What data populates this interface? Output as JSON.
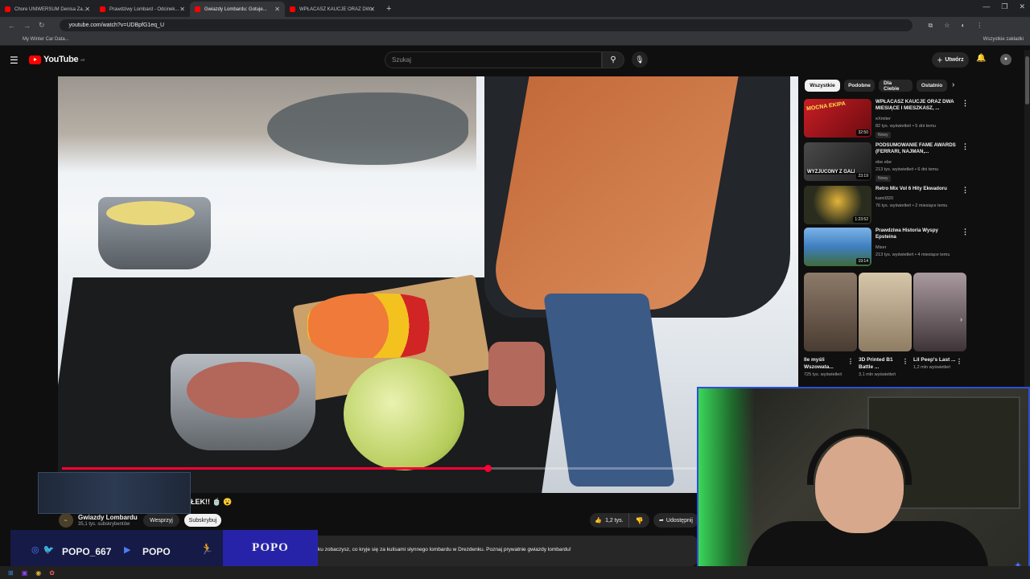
{
  "browser": {
    "tabs": [
      {
        "label": "Chore UNIWERSUM Denisa Za..."
      },
      {
        "label": "Prawdziwy Lombard - Odcinek..."
      },
      {
        "label": "Gwiazdy Lombardu: Gotuje..."
      },
      {
        "label": "WPŁACASZ KAUCJE ORAZ DW..."
      }
    ],
    "url": "youtube.com/watch?v=UDBpfG1eq_U",
    "bookmark": "My Winter Car Data...",
    "all_bookmarks": "Wszystkie zakładki"
  },
  "youtube": {
    "logo": "YouTube",
    "logo_region": "MT",
    "search_placeholder": "Szukaj",
    "create_label": "Utwórz"
  },
  "video": {
    "title_partial": "ŁEK!! 🍵 😮",
    "progress": 0.67,
    "channel": "Gwiazdy Lombardu",
    "subscribers": "35,1 tys. subskrybentów",
    "support_label": "Wesprzyj",
    "subscribe_label": "Subskrybuj",
    "likes": "1,2 tys.",
    "share_label": "Udostępnij",
    "description": "ku zobaczysz, co kryje się za kulisami słynnego lombardu w Drezdenku. Poznaj prywatnie gwiazdy lombardu!"
  },
  "chips": [
    "Wszystkie",
    "Podobne",
    "Dla Ciebie",
    "Ostatnio"
  ],
  "recommendations": [
    {
      "title": "WPŁACASZ KAUCJE ORAZ DWA MIESIĄCE I MIESZKASZ, ...",
      "channel": "eXmiter",
      "meta": "82 tys. wyświetleń • 5 dni temu",
      "badge": "Nowy",
      "duration": "32:50",
      "thumb_label": "MOCNA EKIPA",
      "color": "#b3161f"
    },
    {
      "title": "PODSUMOWANIE FAME AWARDS (FERRARI, NAJMAN,...",
      "channel": "ebe ebe",
      "meta": "213 tys. wyświetleń • 6 dni temu",
      "badge": "Nowy",
      "duration": "23:19",
      "thumb_label": "WYZJUCONY Z GALI",
      "color": "#3a3a3a"
    },
    {
      "title": "Retro Mix Vol 6 Hity Ekwadoru",
      "channel": "kamil320",
      "meta": "76 tys. wyświetleń • 2 miesiące temu",
      "badge": "",
      "duration": "1:23:52",
      "thumb_label": "",
      "color": "#2a2d1e"
    },
    {
      "title": "Prawdziwa Historia Wyspy Epsteina",
      "channel": "Mixer",
      "meta": "213 tys. wyświetleń • 4 miesiące temu",
      "badge": "",
      "duration": "19:14",
      "thumb_label": "",
      "color": "#3e7fbf"
    }
  ],
  "shorts": [
    {
      "title": "Ile myśli Wszowata...",
      "views": "725 tys. wyświetleń",
      "color": "#6e5a4a"
    },
    {
      "title": "3D Printed B1 Battle ...",
      "views": "3,1 mln wyświetleń",
      "color": "#b7a58a"
    },
    {
      "title": "Lil Peep's Last ...",
      "views": "1,2 mln wyświetleń",
      "color": "#6c5f63"
    }
  ],
  "overlay": {
    "handle1": "POPO_667",
    "handle2": "POPO",
    "brand": "POPO"
  },
  "colors": {
    "accent": "#ff0033",
    "overlay_blue": "#2723a8",
    "webcam_border": "#2f4fd6"
  }
}
